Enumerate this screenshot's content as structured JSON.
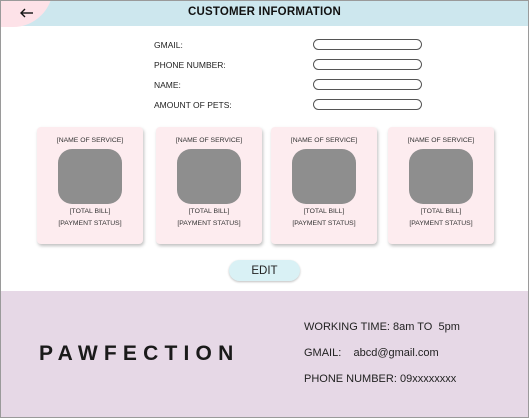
{
  "header": {
    "title": "CUSTOMER INFORMATION",
    "back_icon": "arrow-left-icon",
    "colors": {
      "bar": "#cde7ee",
      "back_blob": "#fde2e8"
    }
  },
  "form": {
    "fields": [
      {
        "label": "GMAIL:",
        "value": ""
      },
      {
        "label": "PHONE NUMBER:",
        "value": ""
      },
      {
        "label": "NAME:",
        "value": ""
      },
      {
        "label": "AMOUNT OF PETS:",
        "value": ""
      }
    ]
  },
  "cards": [
    {
      "service": "[NAME OF SERVICE]",
      "bill": "[TOTAL BILL]",
      "status": "[PAYMENT STATUS]"
    },
    {
      "service": "[NAME OF SERVICE]",
      "bill": "[TOTAL BILL]",
      "status": "[PAYMENT STATUS]"
    },
    {
      "service": "[NAME OF SERVICE]",
      "bill": "[TOTAL BILL]",
      "status": "[PAYMENT STATUS]"
    },
    {
      "service": "[NAME OF SERVICE]",
      "bill": "[TOTAL BILL]",
      "status": "[PAYMENT STATUS]"
    }
  ],
  "edit_label": "EDIT",
  "footer": {
    "brand": "PAWFECTION",
    "working_time": "WORKING TIME: 8am TO  5pm",
    "gmail": "GMAIL:    abcd@gmail.com",
    "phone": "PHONE NUMBER: 09xxxxxxxx",
    "colors": {
      "background": "#e6d8e6",
      "card": "#fdecef",
      "edit_button": "#d9f1f5"
    }
  }
}
